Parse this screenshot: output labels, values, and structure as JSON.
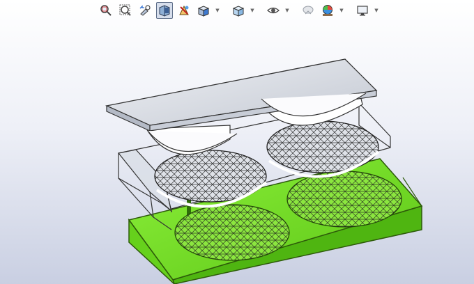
{
  "toolbar": {
    "items": [
      {
        "icon": "zoom-to-fit-icon",
        "active": false,
        "caret": false
      },
      {
        "icon": "zoom-to-area-icon",
        "active": false,
        "caret": false
      },
      {
        "icon": "previous-view-icon",
        "active": false,
        "caret": false
      },
      {
        "icon": "section-view-icon",
        "active": true,
        "caret": false
      },
      {
        "icon": "dynamic-annotation-icon",
        "active": false,
        "caret": false
      },
      {
        "icon": "view-orientation-icon",
        "active": false,
        "caret": true
      },
      {
        "icon": "display-style-icon",
        "active": false,
        "caret": true
      },
      {
        "icon": "hide-show-items-icon",
        "active": false,
        "caret": true
      },
      {
        "icon": "edit-appearance-icon",
        "active": false,
        "caret": false
      },
      {
        "icon": "apply-scene-icon",
        "active": false,
        "caret": true
      },
      {
        "icon": "view-settings-icon",
        "active": false,
        "caret": true
      }
    ]
  },
  "colors": {
    "mold_green": "#7de22a",
    "mold_green_dark": "#3e8a10",
    "top_plate": "#d9dde6",
    "mesh": "#1d1d1d",
    "frame": "#bcc2cc"
  }
}
